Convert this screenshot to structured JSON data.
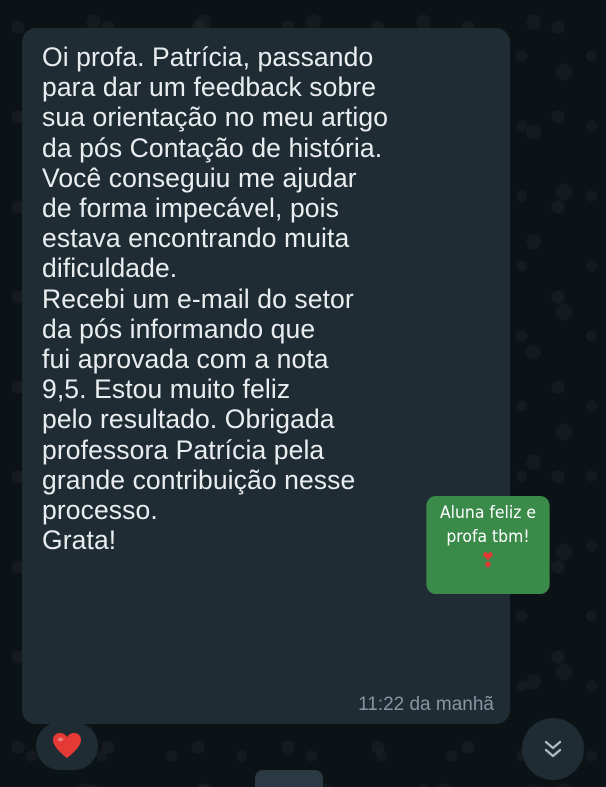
{
  "message": {
    "text": "Oi profa. Patrícia, passando\npara dar um feedback sobre\nsua orientação no meu artigo\nda pós Contação de história.\nVocê conseguiu me ajudar\nde forma impecável, pois\nestava encontrando muita\ndificuldade.\nRecebi um e-mail do setor\nda pós informando que\nfui aprovada com a nota\n9,5. Estou muito feliz\npelo resultado. Obrigada\nprofessora Patrícia pela\ngrande contribuição nesse\nprocesso.\nGrata!",
    "time": "11:22 da manhã"
  },
  "sticker": {
    "line1": "Aluna feliz e",
    "line2": "profa tbm!",
    "emoji": "❣"
  },
  "reaction": {
    "icon": "red-heart-icon",
    "color": "#e53935"
  },
  "scroll_button": {
    "icon": "double-chevron-down-icon"
  },
  "colors": {
    "bubble": "#1f2c33",
    "background": "#0c1317",
    "text": "#e9edef",
    "timestamp": "#8696a0",
    "sticker": "#3a8a4a"
  }
}
